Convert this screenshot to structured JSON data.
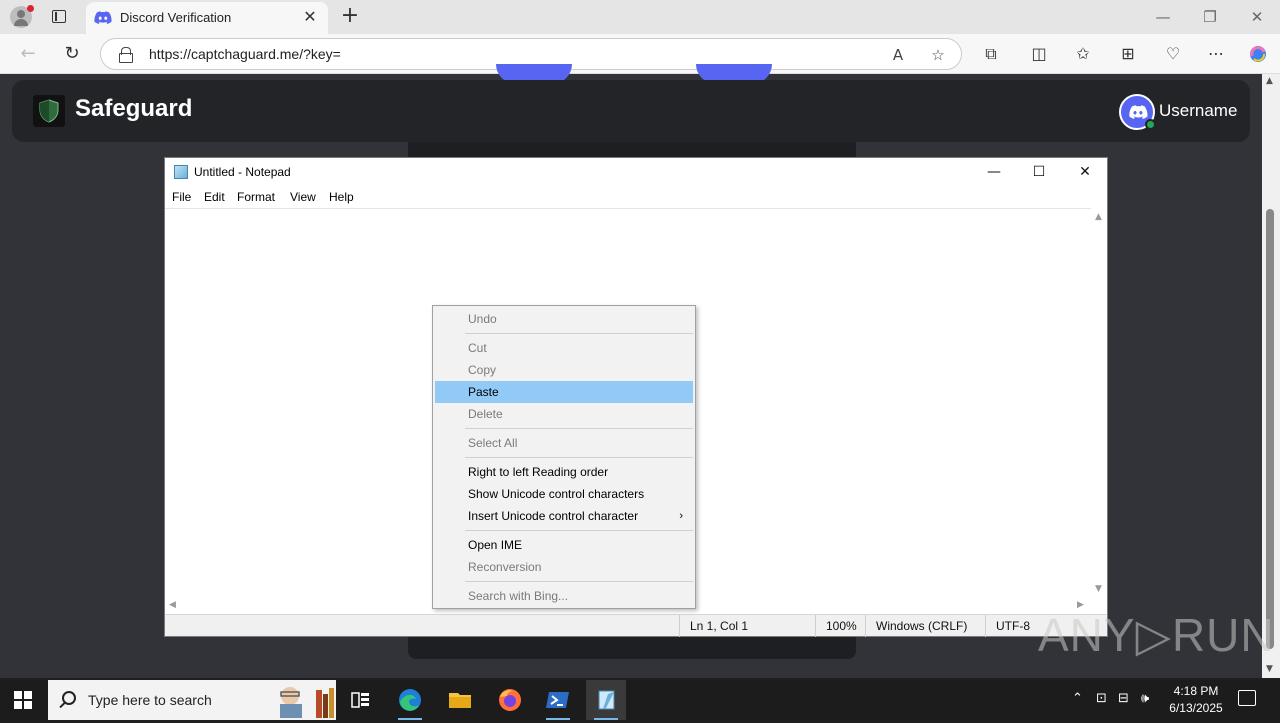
{
  "browser": {
    "tab_title": "Discord Verification",
    "tab_close": "✕",
    "new_tab": "+",
    "url": "https://captchaguard.me/?key=",
    "window_controls": {
      "minimize": "—",
      "restore": "❐",
      "close": "✕"
    }
  },
  "page": {
    "brand": "Safeguard",
    "username": "Username"
  },
  "notepad": {
    "title": "Untitled - Notepad",
    "menu": [
      "File",
      "Edit",
      "Format",
      "View",
      "Help"
    ],
    "controls": {
      "minimize": "—",
      "maximize": "☐",
      "close": "✕"
    },
    "status": {
      "position": "Ln 1, Col 1",
      "zoom": "100%",
      "line_endings": "Windows (CRLF)",
      "encoding": "UTF-8"
    }
  },
  "context_menu": {
    "items": [
      {
        "label": "Undo",
        "enabled": false
      },
      {
        "label": "Cut",
        "enabled": false
      },
      {
        "label": "Copy",
        "enabled": false
      },
      {
        "label": "Paste",
        "enabled": true,
        "highlighted": true
      },
      {
        "label": "Delete",
        "enabled": false
      },
      {
        "label": "Select All",
        "enabled": false
      },
      {
        "label": "Right to left Reading order",
        "enabled": true
      },
      {
        "label": "Show Unicode control characters",
        "enabled": true
      },
      {
        "label": "Insert Unicode control character",
        "enabled": true,
        "submenu": true
      },
      {
        "label": "Open IME",
        "enabled": true
      },
      {
        "label": "Reconversion",
        "enabled": false
      },
      {
        "label": "Search with Bing...",
        "enabled": false
      }
    ],
    "submenu_arrow": "›"
  },
  "watermark": "ANY▷RUN",
  "taskbar": {
    "search_placeholder": "Type here to search",
    "clock_time": "4:18 PM",
    "clock_date": "6/13/2025",
    "apps": [
      "task-view",
      "edge",
      "file-explorer",
      "firefox",
      "powershell",
      "notepad"
    ]
  },
  "colors": {
    "discord_blurple": "#5865f2",
    "page_bg": "#313338",
    "menu_highlight": "#91c9f7",
    "online_green": "#23a55a"
  }
}
